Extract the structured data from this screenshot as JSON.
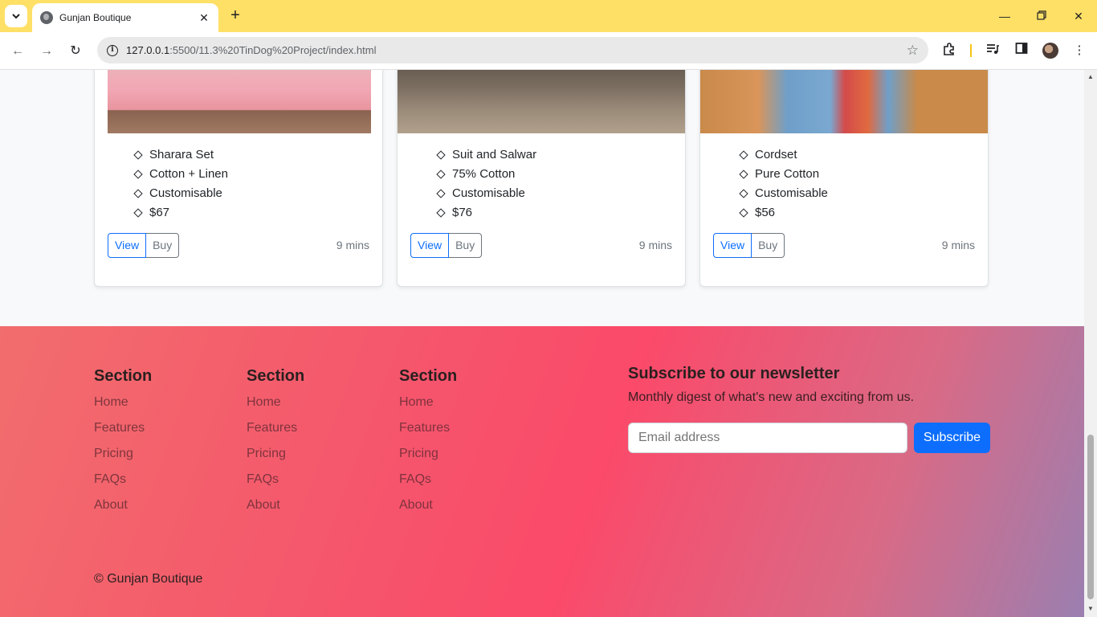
{
  "browser": {
    "tab_title": "Gunjan Boutique",
    "url_host": "127.0.0.1",
    "url_rest": ":5500/11.3%20TinDog%20Project/index.html"
  },
  "cards": [
    {
      "items": [
        "Sharara Set",
        "Cotton + Linen",
        "Customisable",
        "$67"
      ],
      "view_label": "View",
      "buy_label": "Buy",
      "time": "9 mins"
    },
    {
      "items": [
        "Suit and Salwar",
        "75% Cotton",
        "Customisable",
        "$76"
      ],
      "view_label": "View",
      "buy_label": "Buy",
      "time": "9 mins"
    },
    {
      "items": [
        "Cordset",
        "Pure Cotton",
        "Customisable",
        "$56"
      ],
      "view_label": "View",
      "buy_label": "Buy",
      "time": "9 mins"
    }
  ],
  "footer": {
    "columns": [
      {
        "heading": "Section",
        "links": [
          "Home",
          "Features",
          "Pricing",
          "FAQs",
          "About"
        ]
      },
      {
        "heading": "Section",
        "links": [
          "Home",
          "Features",
          "Pricing",
          "FAQs",
          "About"
        ]
      },
      {
        "heading": "Section",
        "links": [
          "Home",
          "Features",
          "Pricing",
          "FAQs",
          "About"
        ]
      }
    ],
    "newsletter": {
      "title": "Subscribe to our newsletter",
      "subtitle": "Monthly digest of what's new and exciting from us.",
      "email_placeholder": "Email address",
      "button_label": "Subscribe"
    },
    "copyright": "© Gunjan Boutique"
  },
  "colors": {
    "tabbar": "#ffe066",
    "primary": "#0d6efd",
    "footer_gradient": [
      "#f26d6d",
      "#fb4a6a",
      "#9b7fb0"
    ]
  }
}
